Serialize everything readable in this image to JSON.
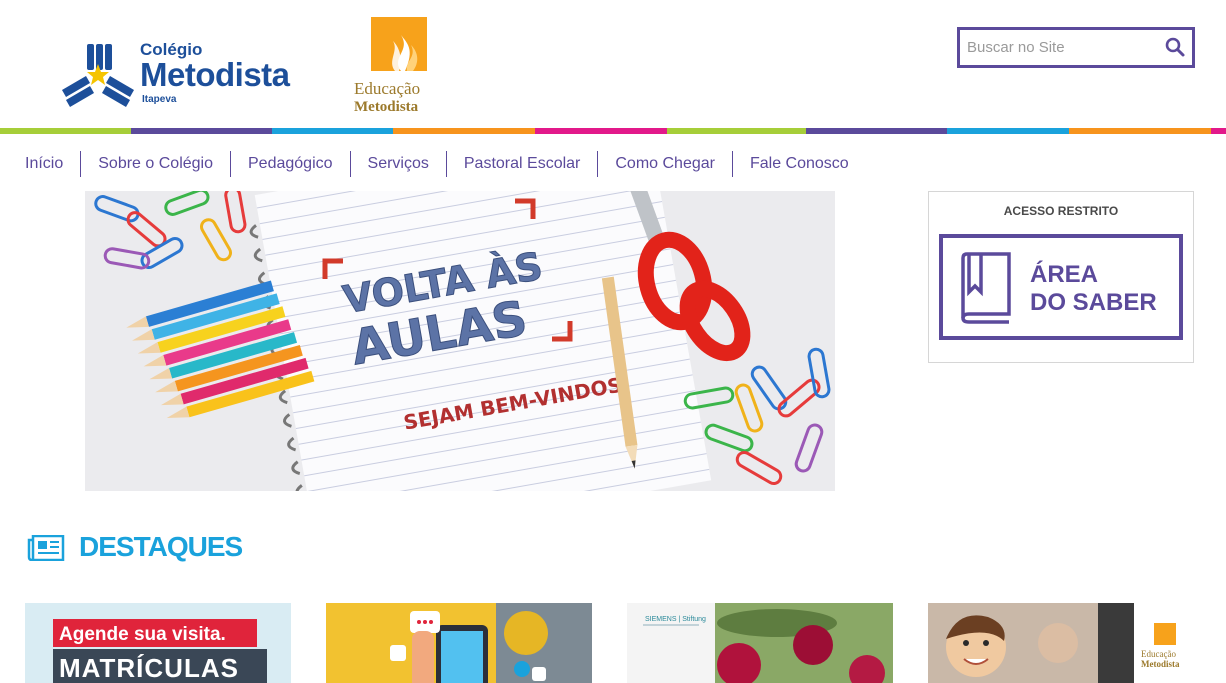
{
  "header": {
    "logo_metodista": {
      "small": "Colégio",
      "big": "Metodista",
      "sub": "Itapeva"
    },
    "logo_educacao": {
      "line1": "Educação",
      "line2": "Metodista"
    },
    "search": {
      "placeholder": "Buscar no Site",
      "icon": "search-icon"
    }
  },
  "stripe_colors": [
    "#a6ce39",
    "#5b4a9b",
    "#1aa2dc",
    "#f7941d",
    "#e2198a",
    "#a6ce39",
    "#5b4a9b",
    "#1aa2dc",
    "#f7941d",
    "#e2198a"
  ],
  "nav": {
    "items": [
      {
        "label": "Início"
      },
      {
        "label": "Sobre o Colégio"
      },
      {
        "label": "Pedagógico"
      },
      {
        "label": "Serviços"
      },
      {
        "label": "Pastoral Escolar"
      },
      {
        "label": "Como Chegar"
      },
      {
        "label": "Fale Conosco"
      }
    ]
  },
  "banner": {
    "title_line1": "VOLTA ÀS",
    "title_line2": "AULAS",
    "subtitle": "SEJAM BEM-VINDOS!"
  },
  "acesso_restrito": {
    "title": "ACESSO RESTRITO",
    "link_line1": "ÁREA",
    "link_line2": "DO SABER",
    "icon": "book-icon"
  },
  "destaques": {
    "title": "DESTAQUES",
    "icon": "newspaper-icon",
    "cards": [
      {
        "line1": "Agende sua visita.",
        "line2": "MATRÍCULAS"
      },
      {
        "icon": "phone-apps-icon"
      },
      {
        "caption": "SIEMENS | Stiftung"
      },
      {
        "logo_line1": "Educação",
        "logo_line2": "Metodista"
      }
    ]
  },
  "colors": {
    "primary": "#5b4a9b",
    "accent_blue": "#1aa2dc",
    "brand_blue": "#1d4f9a",
    "brand_orange": "#f7a21b"
  }
}
